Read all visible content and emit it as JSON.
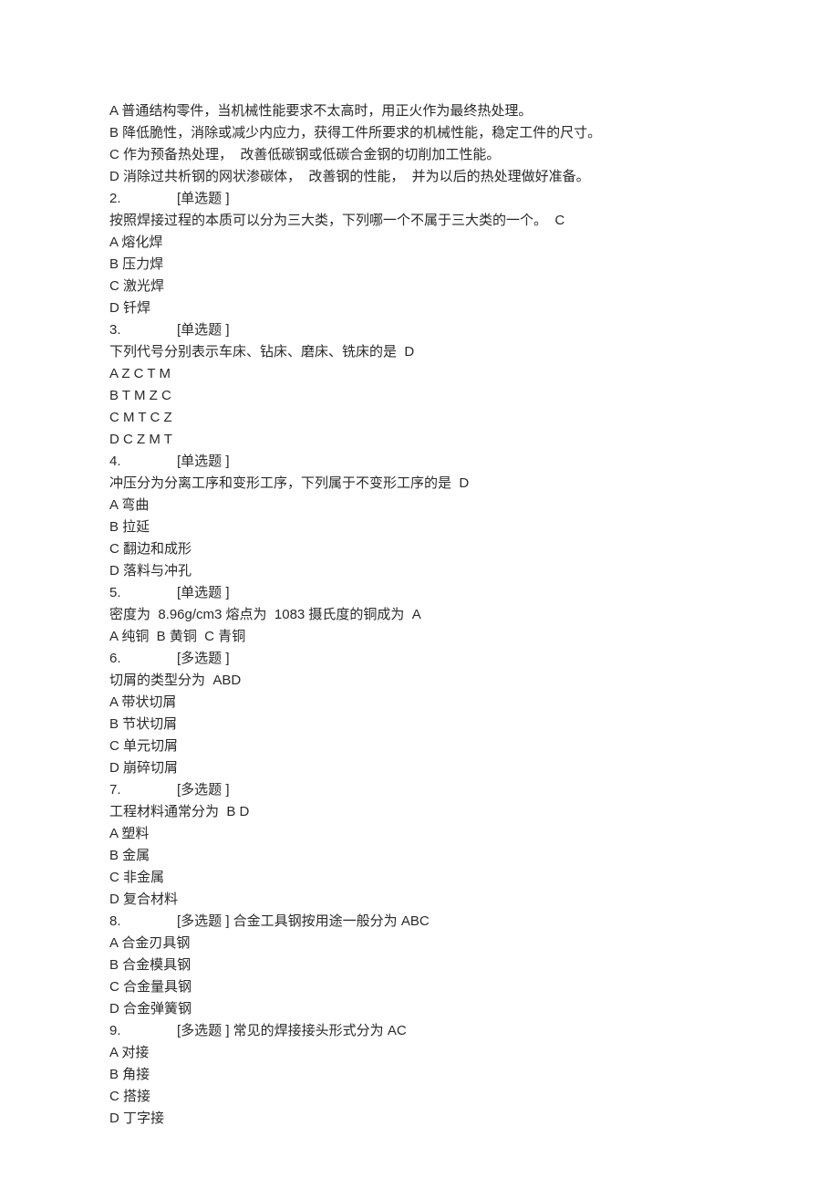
{
  "lines": [
    {
      "text": "A 普通结构零件，当机械性能要求不太高时，用正火作为最终热处理。"
    },
    {
      "text": "B 降低脆性，消除或减少内应力，获得工件所要求的机械性能，稳定工件的尺寸。"
    },
    {
      "text": "C 作为预备热处理，  改善低碳钢或低碳合金钢的切削加工性能。"
    },
    {
      "text": "D 消除过共析钢的网状渗碳体，  改善钢的性能，  并为以后的热处理做好准备。"
    },
    {
      "num": "2.",
      "tag": "[单选题 ]"
    },
    {
      "text": "按照焊接过程的本质可以分为三大类，下列哪一个不属于三大类的一个。  C"
    },
    {
      "text": "A 熔化焊"
    },
    {
      "text": "B 压力焊"
    },
    {
      "text": "C 激光焊"
    },
    {
      "text": "D 钎焊"
    },
    {
      "num": "3.",
      "tag": "[单选题 ]"
    },
    {
      "text": "下列代号分别表示车床、钻床、磨床、铣床的是  D"
    },
    {
      "text": "A Z C T M"
    },
    {
      "text": "B T M Z C"
    },
    {
      "text": "C M T C Z"
    },
    {
      "text": "D C Z M T"
    },
    {
      "num": "4.",
      "tag": "[单选题 ]"
    },
    {
      "text": "冲压分为分离工序和变形工序，下列属于不变形工序的是  D"
    },
    {
      "text": "A 弯曲"
    },
    {
      "text": "B 拉延"
    },
    {
      "text": "C 翻边和成形"
    },
    {
      "text": "D 落料与冲孔"
    },
    {
      "num": "5.",
      "tag": "[单选题 ]"
    },
    {
      "text": "密度为  8.96g/cm3 熔点为  1083 摄氏度的铜成为  A"
    },
    {
      "text": "A 纯铜  B 黄铜  C 青铜"
    },
    {
      "num": "6.",
      "tag": "[多选题 ]"
    },
    {
      "text": "切屑的类型分为  ABD"
    },
    {
      "text": "A 带状切屑"
    },
    {
      "text": "B 节状切屑"
    },
    {
      "text": "C 单元切屑"
    },
    {
      "text": "D 崩碎切屑"
    },
    {
      "num": "7.",
      "tag": "[多选题 ]"
    },
    {
      "text": "工程材料通常分为  B D"
    },
    {
      "text": "A 塑料"
    },
    {
      "text": "B 金属"
    },
    {
      "text": "C 非金属"
    },
    {
      "text": "D 复合材料"
    },
    {
      "num": "8.",
      "tag": "[多选题 ] 合金工具钢按用途一般分为  ABC"
    },
    {
      "text": "A 合金刃具钢"
    },
    {
      "text": "B 合金模具钢"
    },
    {
      "text": "C 合金量具钢"
    },
    {
      "text": "D 合金弹簧钢"
    },
    {
      "num": "9.",
      "tag": "[多选题 ] 常见的焊接接头形式分为  AC"
    },
    {
      "text": "A 对接"
    },
    {
      "text": "B 角接"
    },
    {
      "text": "C 搭接"
    },
    {
      "text": "D 丁字接"
    }
  ]
}
